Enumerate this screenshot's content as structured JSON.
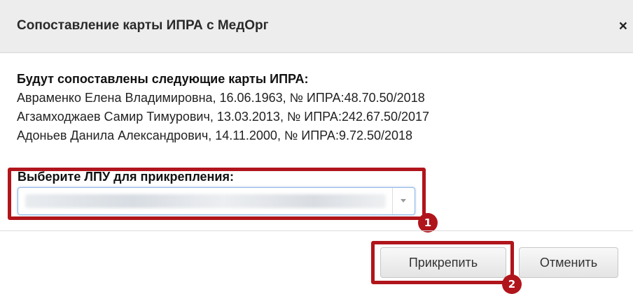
{
  "dialog": {
    "title": "Сопоставление карты ИПРА с МедОрг",
    "close_glyph": "×"
  },
  "cards": {
    "heading": "Будут сопоставлены следующие карты ИПРА:",
    "items": [
      "Авраменко Елена Владимировна, 16.06.1963, № ИПРА:48.70.50/2018",
      "Агзамходжаев Самир Тимурович, 13.03.2013, № ИПРА:242.67.50/2017",
      "Адоньев Данила Александрович, 14.11.2000, № ИПРА:9.72.50/2018"
    ]
  },
  "lpu": {
    "label": "Выберите ЛПУ для прикрепления:",
    "selected_value": ""
  },
  "buttons": {
    "attach_label": "Прикрепить",
    "cancel_label": "Отменить"
  },
  "markers": {
    "first": "1",
    "second": "2"
  },
  "colors": {
    "highlight": "#b0151b",
    "header_bg": "#ededed",
    "focus_border": "#8fb6e8"
  },
  "icons": {
    "close": "close-icon",
    "dropdown": "chevron-down-icon"
  }
}
